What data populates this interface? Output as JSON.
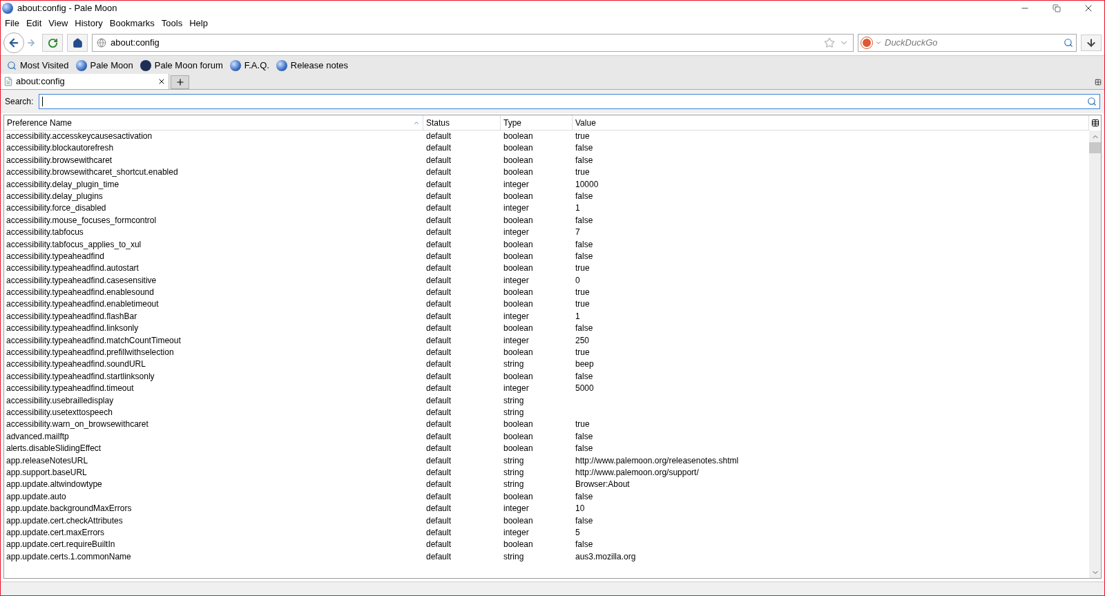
{
  "window": {
    "title": "about:config - Pale Moon"
  },
  "menu": [
    {
      "label": "File"
    },
    {
      "label": "Edit"
    },
    {
      "label": "View"
    },
    {
      "label": "History"
    },
    {
      "label": "Bookmarks"
    },
    {
      "label": "Tools"
    },
    {
      "label": "Help"
    }
  ],
  "address_bar": {
    "value": "about:config"
  },
  "search_engine": {
    "placeholder": "DuckDuckGo"
  },
  "bookmarks": [
    {
      "label": "Most Visited",
      "kind": "folder"
    },
    {
      "label": "Pale Moon",
      "kind": "globe"
    },
    {
      "label": "Pale Moon forum",
      "kind": "forum"
    },
    {
      "label": "F.A.Q.",
      "kind": "globe"
    },
    {
      "label": "Release notes",
      "kind": "globe"
    }
  ],
  "tabs": [
    {
      "label": "about:config",
      "selected": true
    }
  ],
  "search": {
    "label": "Search:"
  },
  "table": {
    "columns": [
      "Preference Name",
      "Status",
      "Type",
      "Value"
    ],
    "rows": [
      {
        "name": "accessibility.accesskeycausesactivation",
        "status": "default",
        "type": "boolean",
        "value": "true"
      },
      {
        "name": "accessibility.blockautorefresh",
        "status": "default",
        "type": "boolean",
        "value": "false"
      },
      {
        "name": "accessibility.browsewithcaret",
        "status": "default",
        "type": "boolean",
        "value": "false"
      },
      {
        "name": "accessibility.browsewithcaret_shortcut.enabled",
        "status": "default",
        "type": "boolean",
        "value": "true"
      },
      {
        "name": "accessibility.delay_plugin_time",
        "status": "default",
        "type": "integer",
        "value": "10000"
      },
      {
        "name": "accessibility.delay_plugins",
        "status": "default",
        "type": "boolean",
        "value": "false"
      },
      {
        "name": "accessibility.force_disabled",
        "status": "default",
        "type": "integer",
        "value": "1"
      },
      {
        "name": "accessibility.mouse_focuses_formcontrol",
        "status": "default",
        "type": "boolean",
        "value": "false"
      },
      {
        "name": "accessibility.tabfocus",
        "status": "default",
        "type": "integer",
        "value": "7"
      },
      {
        "name": "accessibility.tabfocus_applies_to_xul",
        "status": "default",
        "type": "boolean",
        "value": "false"
      },
      {
        "name": "accessibility.typeaheadfind",
        "status": "default",
        "type": "boolean",
        "value": "false"
      },
      {
        "name": "accessibility.typeaheadfind.autostart",
        "status": "default",
        "type": "boolean",
        "value": "true"
      },
      {
        "name": "accessibility.typeaheadfind.casesensitive",
        "status": "default",
        "type": "integer",
        "value": "0"
      },
      {
        "name": "accessibility.typeaheadfind.enablesound",
        "status": "default",
        "type": "boolean",
        "value": "true"
      },
      {
        "name": "accessibility.typeaheadfind.enabletimeout",
        "status": "default",
        "type": "boolean",
        "value": "true"
      },
      {
        "name": "accessibility.typeaheadfind.flashBar",
        "status": "default",
        "type": "integer",
        "value": "1"
      },
      {
        "name": "accessibility.typeaheadfind.linksonly",
        "status": "default",
        "type": "boolean",
        "value": "false"
      },
      {
        "name": "accessibility.typeaheadfind.matchCountTimeout",
        "status": "default",
        "type": "integer",
        "value": "250"
      },
      {
        "name": "accessibility.typeaheadfind.prefillwithselection",
        "status": "default",
        "type": "boolean",
        "value": "true"
      },
      {
        "name": "accessibility.typeaheadfind.soundURL",
        "status": "default",
        "type": "string",
        "value": "beep"
      },
      {
        "name": "accessibility.typeaheadfind.startlinksonly",
        "status": "default",
        "type": "boolean",
        "value": "false"
      },
      {
        "name": "accessibility.typeaheadfind.timeout",
        "status": "default",
        "type": "integer",
        "value": "5000"
      },
      {
        "name": "accessibility.usebrailledisplay",
        "status": "default",
        "type": "string"
      },
      {
        "name": "accessibility.usetexttospeech",
        "status": "default",
        "type": "string"
      },
      {
        "name": "accessibility.warn_on_browsewithcaret",
        "status": "default",
        "type": "boolean",
        "value": "true"
      },
      {
        "name": "advanced.mailftp",
        "status": "default",
        "type": "boolean",
        "value": "false"
      },
      {
        "name": "alerts.disableSlidingEffect",
        "status": "default",
        "type": "boolean",
        "value": "false"
      },
      {
        "name": "app.releaseNotesURL",
        "status": "default",
        "type": "string",
        "value": "http://www.palemoon.org/releasenotes.shtml"
      },
      {
        "name": "app.support.baseURL",
        "status": "default",
        "type": "string",
        "value": "http://www.palemoon.org/support/"
      },
      {
        "name": "app.update.altwindowtype",
        "status": "default",
        "type": "string",
        "value": "Browser:About"
      },
      {
        "name": "app.update.auto",
        "status": "default",
        "type": "boolean",
        "value": "false"
      },
      {
        "name": "app.update.backgroundMaxErrors",
        "status": "default",
        "type": "integer",
        "value": "10"
      },
      {
        "name": "app.update.cert.checkAttributes",
        "status": "default",
        "type": "boolean",
        "value": "false"
      },
      {
        "name": "app.update.cert.maxErrors",
        "status": "default",
        "type": "integer",
        "value": "5"
      },
      {
        "name": "app.update.cert.requireBuiltIn",
        "status": "default",
        "type": "boolean",
        "value": "false"
      },
      {
        "name": "app.update.certs.1.commonName",
        "status": "default",
        "type": "string",
        "value": "aus3.mozilla.org"
      }
    ]
  }
}
